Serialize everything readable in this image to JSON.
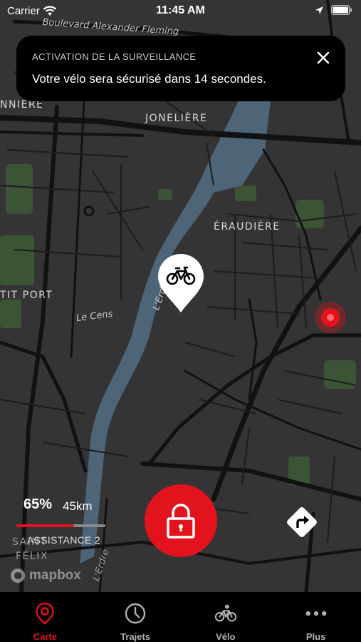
{
  "status_bar": {
    "carrier": "Carrier",
    "time": "11:45 AM"
  },
  "toast": {
    "title": "ACTIVATION DE LA SURVEILLANCE",
    "message": "Votre vélo sera sécurisé dans 14 secondes."
  },
  "map": {
    "labels": {
      "boulevard": "Boulevard Alexander Fleming",
      "nniere": "NNIÈRE",
      "joneliere": "JONELIÈRE",
      "eraudiere": "ÉRAUDIÈRE",
      "petit_port": "TIT PORT",
      "le_cens": "Le Cens",
      "erdre_north": "L'Erdre",
      "erdre_south": "L'Erdre",
      "saint_felix_1": "SAINT",
      "saint_felix_2": "FÉLIX"
    },
    "attribution": "mapbox"
  },
  "bike_status": {
    "battery_percent": "65%",
    "battery_level": 0.65,
    "range": "45km",
    "assist_level": "ASSISTANCE 2"
  },
  "colors": {
    "accent": "#e3131e",
    "map_background": "#343434",
    "water": "#4d6577",
    "roads": "#111111"
  },
  "tabs": [
    {
      "label": "Carte",
      "icon": "map-pin-icon",
      "active": true
    },
    {
      "label": "Trajets",
      "icon": "clock-icon",
      "active": false
    },
    {
      "label": "Vélo",
      "icon": "bicycle-icon",
      "active": false
    },
    {
      "label": "Plus",
      "icon": "more-dots-icon",
      "active": false
    }
  ]
}
